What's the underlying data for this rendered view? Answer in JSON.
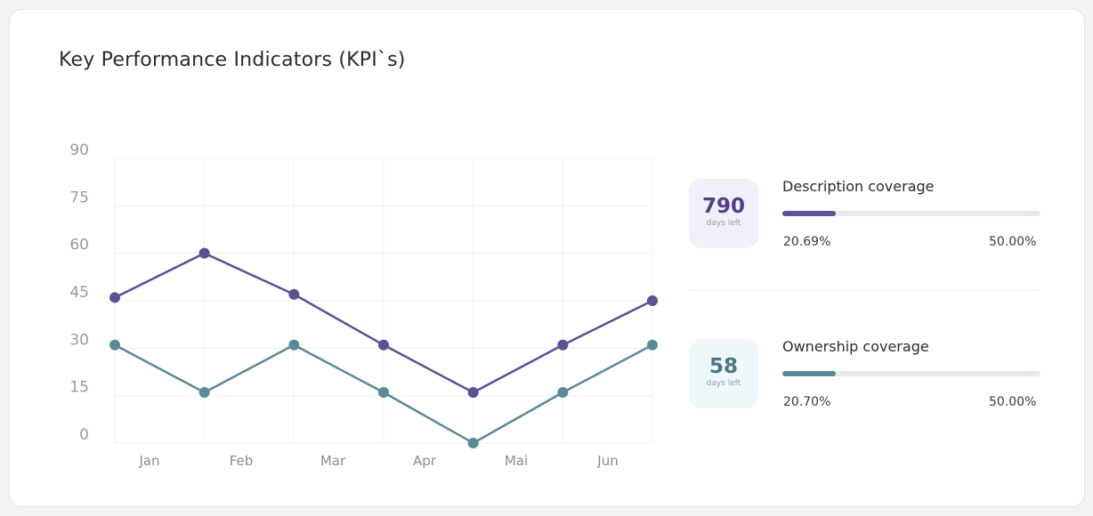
{
  "card": {
    "title": "Key Performance Indicators (KPI`s)"
  },
  "chart_data": {
    "type": "line",
    "categories": [
      "Jan",
      "Feb",
      "Mar",
      "Apr",
      "Mai",
      "Jun"
    ],
    "y_ticks": [
      "0",
      "15",
      "30",
      "45",
      "60",
      "75",
      "90"
    ],
    "ylim": [
      0,
      90
    ],
    "grid": true,
    "legend": "none",
    "series": [
      {
        "color": "#5e4f96",
        "values": [
          46,
          60,
          47,
          31,
          16,
          31,
          45
        ]
      },
      {
        "color": "#5b8a97",
        "values": [
          31,
          16,
          31,
          16,
          0,
          16,
          31
        ]
      }
    ]
  },
  "kpis": [
    {
      "badge_value": "790",
      "badge_caption": "days left",
      "label": "Description coverage",
      "progress": 0.2069,
      "current_text": "20.69%",
      "target_text": "50.00%",
      "badge_bg": "#f1effa",
      "badge_color": "#4f3f86",
      "bar_color": "#5e4f96"
    },
    {
      "badge_value": "58",
      "badge_caption": "days left",
      "label": "Ownership coverage",
      "progress": 0.207,
      "current_text": "20.70%",
      "target_text": "50.00%",
      "badge_bg": "#eef8fb",
      "badge_color": "#4b7785",
      "bar_color": "#5b8a97"
    }
  ]
}
